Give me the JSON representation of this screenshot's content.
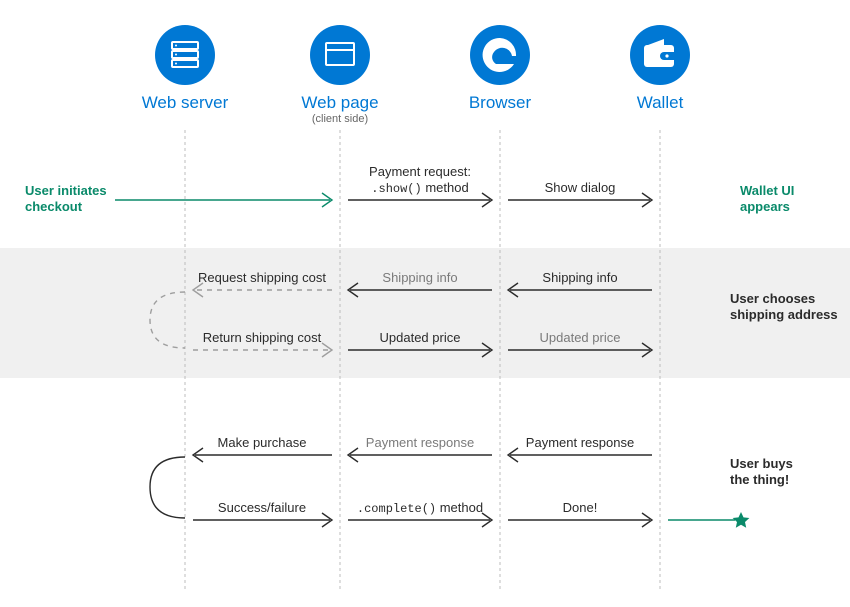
{
  "columns": {
    "webserver": {
      "label": "Web server",
      "icon": "server-icon"
    },
    "webpage": {
      "label": "Web page",
      "sublabel": "(client side)",
      "icon": "window-icon"
    },
    "browser": {
      "label": "Browser",
      "icon": "edge-icon"
    },
    "wallet": {
      "label": "Wallet",
      "icon": "wallet-icon"
    }
  },
  "side": {
    "checkout1": "User initiates",
    "checkout2": "checkout",
    "walletui1": "Wallet UI",
    "walletui2": "appears",
    "ship1": "User chooses",
    "ship2": "shipping address",
    "buy1": "User buys",
    "buy2": "the thing!"
  },
  "row1": {
    "a_label1": "Payment request:",
    "a_label2_pre": "",
    "a_label2_code": ".show()",
    "a_label2_post": " method",
    "b_label": "Show dialog"
  },
  "row2": {
    "req_label": "Request shipping cost",
    "shipinfo_label": "Shipping info",
    "ret_label": "Return shipping cost",
    "upd_label": "Updated price"
  },
  "row3": {
    "make_label": "Make purchase",
    "payresp_label": "Payment response",
    "succ_label": "Success/failure",
    "complete_code": ".complete()",
    "complete_post": " method",
    "done_label": "Done!"
  },
  "colors": {
    "blue": "#0078d4",
    "green": "#0a8a6a",
    "gray": "#9e9e9e",
    "dark": "#2b2b2b",
    "band": "#f0f0f0"
  }
}
